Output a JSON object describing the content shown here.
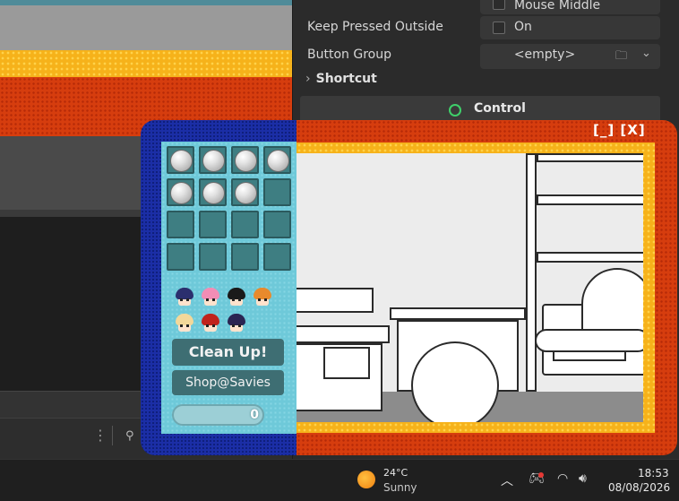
{
  "inspector": {
    "top_row_label": "Mouse Middle",
    "keep_pressed_label": "Keep Pressed Outside",
    "keep_pressed_value": "On",
    "button_group_label": "Button Group",
    "button_group_value": "<empty>",
    "shortcut_label": "Shortcut",
    "control_label": "Control"
  },
  "game": {
    "window_controls": "[_] [X]",
    "clean_up_label": "Clean Up!",
    "shop_label": "Shop@Savies",
    "counter_value": "0",
    "inventory_filled": 7,
    "inventory_slots": 16,
    "characters": [
      "navy-hair",
      "pink-hair",
      "black-cat",
      "orange-hair",
      "blonde",
      "red-hair",
      "navy-hair-2"
    ]
  },
  "taskbar": {
    "temperature": "24°C",
    "condition": "Sunny",
    "time": "18:53",
    "date": "08/08/2026"
  },
  "colors": {
    "accent_green": "#3fcf6a",
    "frame_orange": "#d63d0e",
    "frame_blue": "#1b2ea6",
    "panel_cyan": "#6ec9d9"
  }
}
